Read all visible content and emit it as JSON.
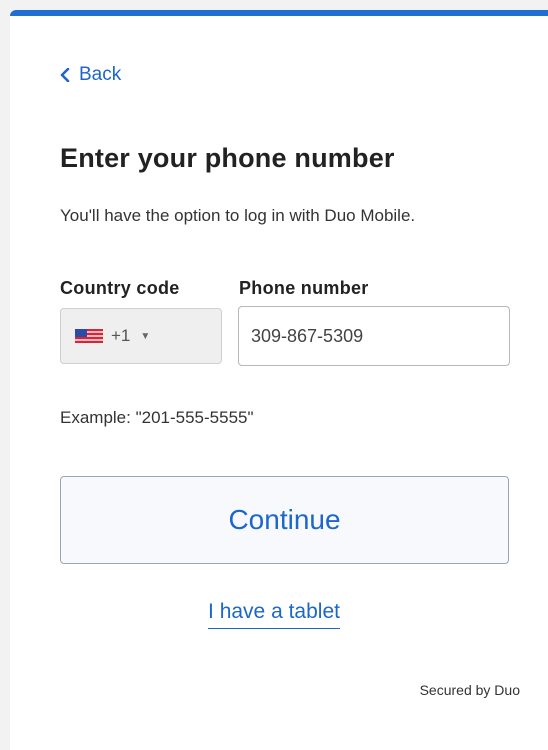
{
  "back": {
    "label": "Back"
  },
  "title": "Enter your phone number",
  "subtitle": "You'll have the option to log in with Duo Mobile.",
  "country": {
    "label": "Country code",
    "flag_icon": "us-flag-icon",
    "value": "+1"
  },
  "phone": {
    "label": "Phone number",
    "value": "309-867-5309"
  },
  "example": "Example: \"201-555-5555\"",
  "continue_label": "Continue",
  "tablet_link": "I have a tablet",
  "footer": "Secured by Duo",
  "colors": {
    "accent": "#1f6fd1",
    "link": "#1d67c8"
  }
}
